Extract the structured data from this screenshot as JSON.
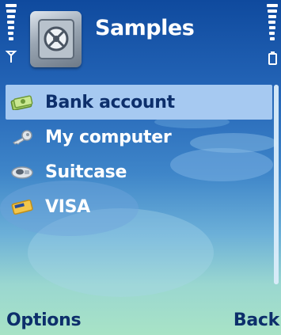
{
  "header": {
    "title": "Samples",
    "icon": "safe-icon"
  },
  "status": {
    "signal_icon": "signal-strength-icon",
    "battery_icon": "battery-icon"
  },
  "list": {
    "items": [
      {
        "label": "Bank account",
        "icon": "money-icon",
        "selected": true
      },
      {
        "label": "My computer",
        "icon": "key-icon",
        "selected": false
      },
      {
        "label": "Suitcase",
        "icon": "lock-icon",
        "selected": false
      },
      {
        "label": "VISA",
        "icon": "credit-card-icon",
        "selected": false
      }
    ]
  },
  "softkeys": {
    "left": "Options",
    "right": "Back"
  },
  "colors": {
    "selection": "#a6c9f1",
    "softkey_text": "#0d2f6b",
    "background_top": "#0f4a9e",
    "background_bottom": "#a8e3c6"
  }
}
